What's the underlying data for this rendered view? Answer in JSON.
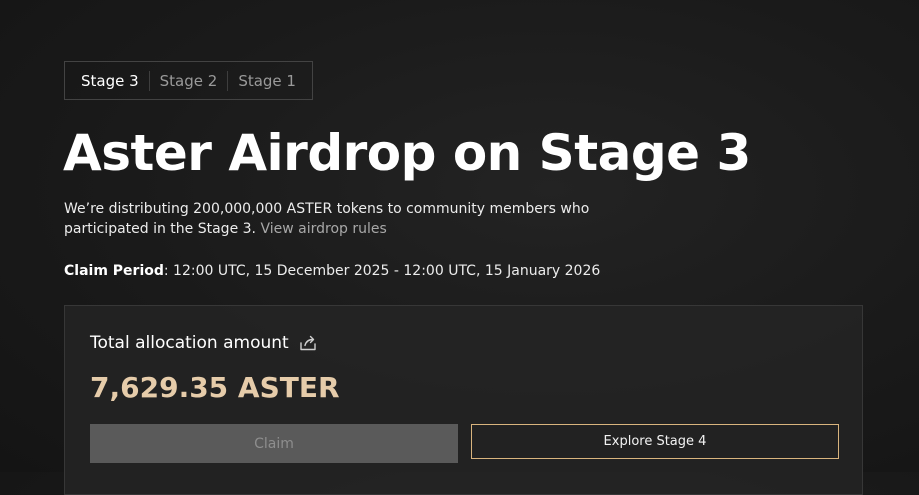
{
  "tabs": [
    {
      "label": "Stage 3",
      "active": true
    },
    {
      "label": "Stage 2",
      "active": false
    },
    {
      "label": "Stage 1",
      "active": false
    }
  ],
  "header": {
    "title": "Aster Airdrop on Stage 3",
    "description": "We’re distributing 200,000,000 ASTER tokens to community members who participated in the Stage 3.",
    "rules_link": "View airdrop rules",
    "claim_period_label": "Claim Period",
    "claim_period_value": ": 12:00 UTC, 15 December 2025 - 12:00 UTC, 15 January 2026"
  },
  "allocation": {
    "title": "Total allocation amount",
    "amount": "7,629.35 ASTER",
    "share_icon": "share-icon"
  },
  "actions": {
    "claim_label": "Claim",
    "explore_label": "Explore Stage 4"
  },
  "colors": {
    "accent_gold": "#e6ccaa",
    "button_border_gold": "#d9b47e",
    "disabled_button_bg": "#5a5a5a"
  }
}
